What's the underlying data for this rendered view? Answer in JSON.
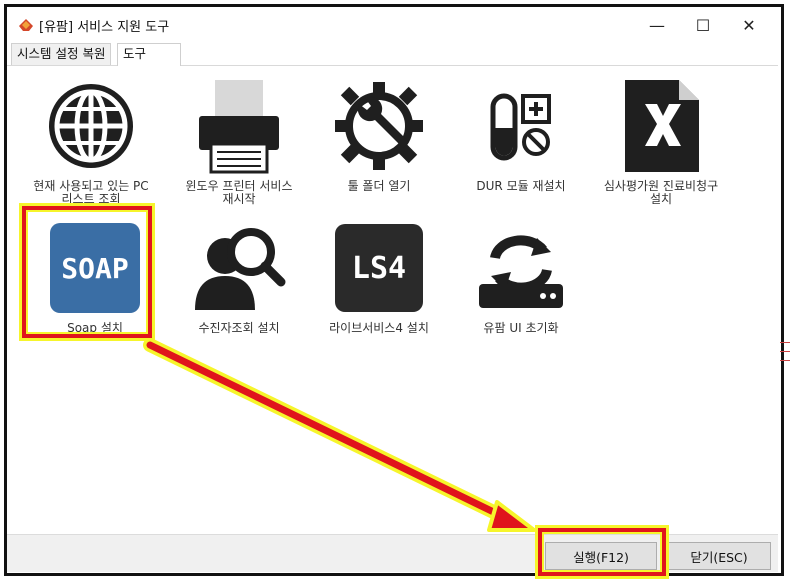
{
  "window": {
    "title": "[유팜] 서비스 지원 도구",
    "minimize": "—",
    "maximize": "☐",
    "close": "✕"
  },
  "tabs": [
    {
      "label": "시스템 설정 복원",
      "active": false
    },
    {
      "label": "도구",
      "active": true
    }
  ],
  "tiles": [
    {
      "label_lines": [
        "현재 사용되고 있는 PC",
        "리스트 조회"
      ],
      "icon": "globe-icon"
    },
    {
      "label_lines": [
        "윈도우 프린터 서비스",
        "재시작"
      ],
      "icon": "printer-icon"
    },
    {
      "label_lines": [
        "툴 폴더 열기"
      ],
      "icon": "gear-wrench-icon"
    },
    {
      "label_lines": [
        "DUR 모듈 재설치"
      ],
      "icon": "dur-module-icon"
    },
    {
      "label_lines": [
        "심사평가원 진료비청구",
        "설치"
      ],
      "icon": "excel-file-icon"
    },
    {
      "label_lines": [
        "Soap 설치"
      ],
      "icon": "soap-icon",
      "selected": true,
      "icon_text": "SOAP"
    },
    {
      "label_lines": [
        "수진자조회 설치"
      ],
      "icon": "user-search-icon"
    },
    {
      "label_lines": [
        "라이브서비스4 설치"
      ],
      "icon": "ls4-icon",
      "icon_text": "LS4"
    },
    {
      "label_lines": [
        "유팜 UI 초기화"
      ],
      "icon": "reset-ui-icon"
    }
  ],
  "footer": {
    "run_label": "실행(F12)",
    "close_label": "닫기(ESC)"
  },
  "colors": {
    "highlight_red": "#e0141c",
    "highlight_yellow": "#f6f52b",
    "soap_blue": "#3a6ea5",
    "icon_dark": "#1f1f1f",
    "selection_blue": "#2d6ed8"
  }
}
